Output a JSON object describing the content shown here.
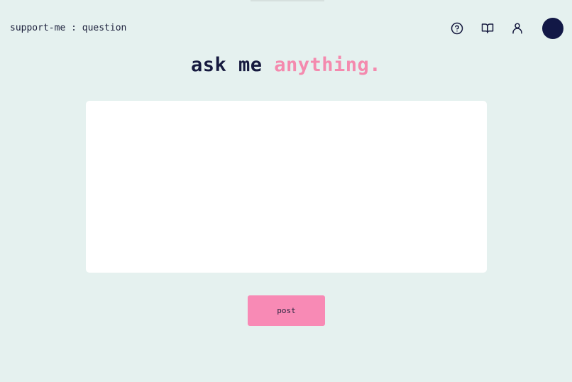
{
  "header": {
    "brand": "support-me : question",
    "icons": [
      "help-circle-icon",
      "book-open-icon",
      "user-icon"
    ]
  },
  "main": {
    "heading_pre": "ask me",
    "heading_accent": "anything.",
    "question_value": "",
    "post_label": "post"
  },
  "colors": {
    "background": "#e5f1ef",
    "text": "#161a3f",
    "accent": "#f48aae",
    "button": "#f88ab5",
    "avatar": "#121846"
  }
}
